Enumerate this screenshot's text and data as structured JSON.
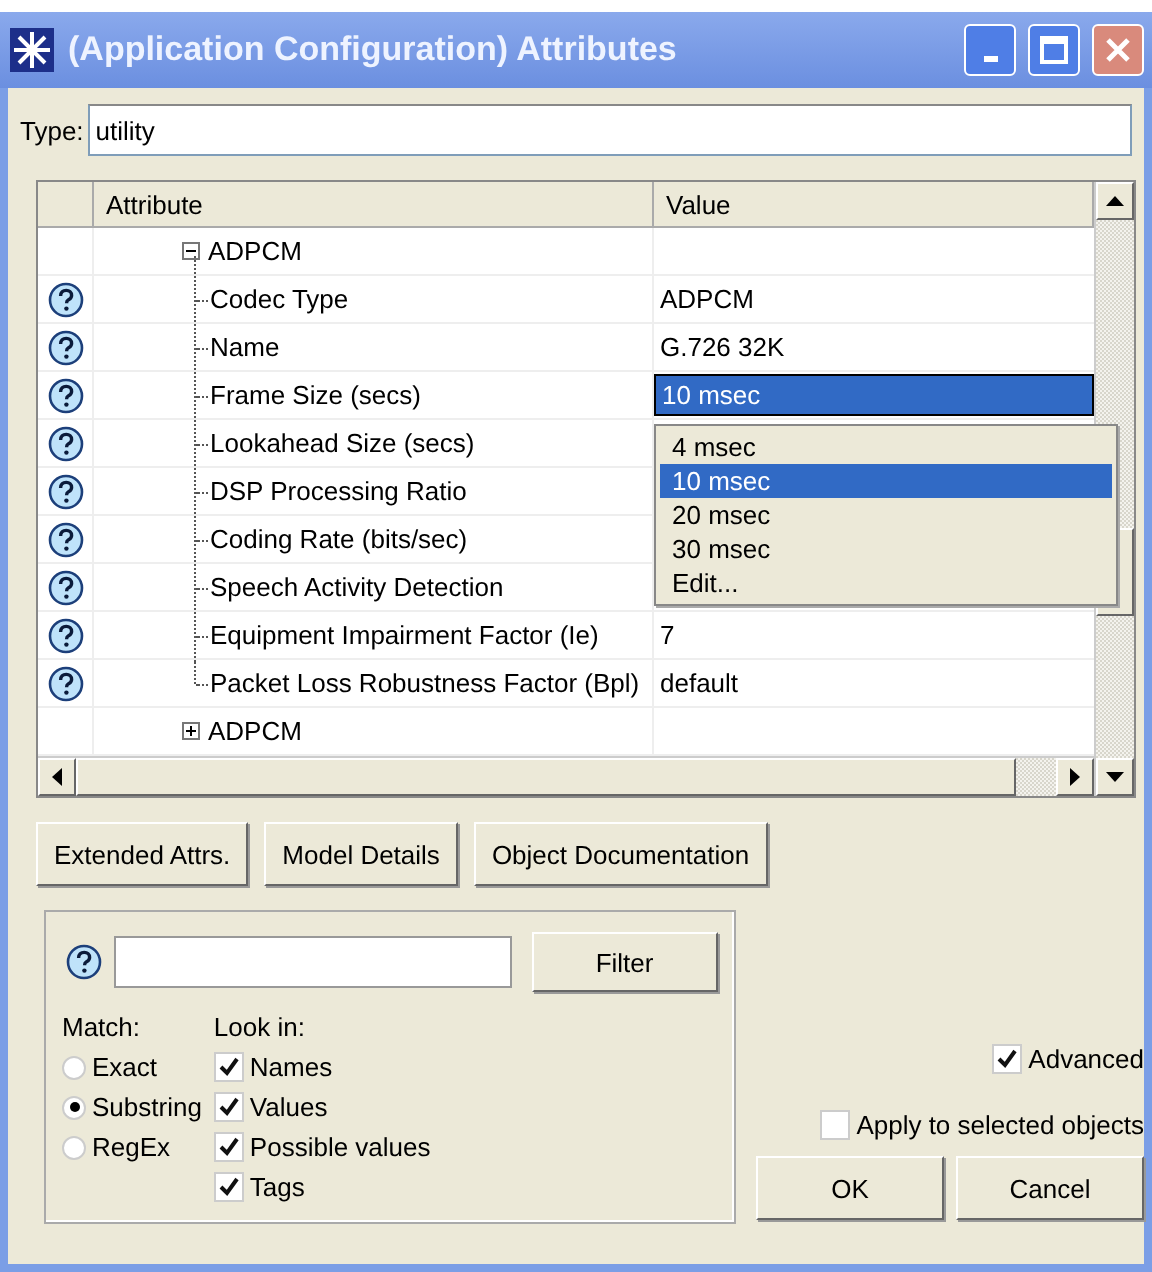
{
  "window": {
    "title": "(Application Configuration) Attributes"
  },
  "type_field": {
    "label": "Type:",
    "value": "utility"
  },
  "table": {
    "columns": [
      "Attribute",
      "Value"
    ],
    "rows": [
      {
        "kind": "group",
        "label": "ADPCM",
        "expanded": true
      },
      {
        "kind": "attr",
        "name": "Codec Type",
        "value": "ADPCM",
        "selected": false
      },
      {
        "kind": "attr",
        "name": "Name",
        "value": "G.726 32K",
        "selected": false
      },
      {
        "kind": "attr",
        "name": "Frame Size (secs)",
        "value": "10 msec",
        "selected": true
      },
      {
        "kind": "attr",
        "name": "Lookahead Size (secs)"
      },
      {
        "kind": "attr",
        "name": "DSP Processing Ratio"
      },
      {
        "kind": "attr",
        "name": "Coding Rate (bits/sec)"
      },
      {
        "kind": "attr",
        "name": "Speech Activity Detection"
      },
      {
        "kind": "attr",
        "name": "Equipment Impairment Factor (Ie)",
        "value": "7",
        "selected": false
      },
      {
        "kind": "attr",
        "name": "Packet Loss Robustness Factor (Bpl)",
        "value": "default",
        "selected": false
      },
      {
        "kind": "group",
        "label": "ADPCM",
        "expanded": false
      }
    ]
  },
  "dropdown": {
    "options": [
      {
        "label": "4 msec",
        "selected": false
      },
      {
        "label": "10 msec",
        "selected": true
      },
      {
        "label": "20 msec",
        "selected": false
      },
      {
        "label": "30 msec",
        "selected": false
      },
      {
        "label": "Edit...",
        "selected": false
      }
    ]
  },
  "buttons": [
    "Extended Attrs.",
    "Model Details",
    "Object Documentation"
  ],
  "filter": {
    "button": "Filter",
    "match_label": "Match:",
    "match_options": [
      {
        "label": "Exact",
        "selected": false
      },
      {
        "label": "Substring",
        "selected": true
      },
      {
        "label": "RegEx",
        "selected": false
      }
    ],
    "look_in_label": "Look in:",
    "look_in": [
      {
        "label": "Names",
        "checked": true
      },
      {
        "label": "Values",
        "checked": true
      },
      {
        "label": "Possible values",
        "checked": true
      },
      {
        "label": "Tags",
        "checked": true
      }
    ]
  },
  "advanced": {
    "label": "Advanced",
    "checked": true
  },
  "apply": {
    "label": "Apply to selected objects",
    "checked": false
  },
  "dialog_buttons": [
    "OK",
    "Cancel"
  ]
}
